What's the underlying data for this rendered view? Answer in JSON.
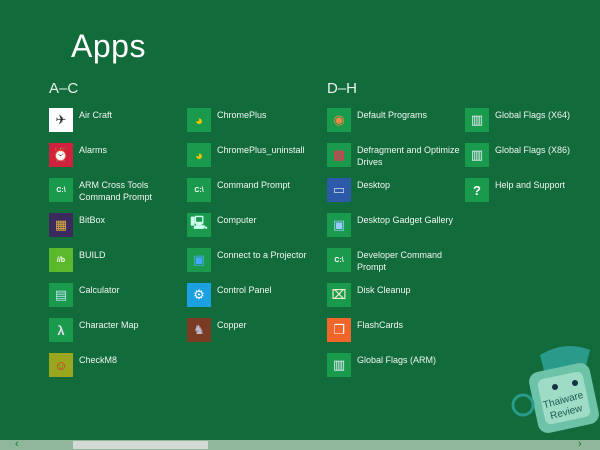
{
  "header": {
    "title": "Apps"
  },
  "groups": [
    {
      "label": "A–C"
    },
    {
      "label": "D–H"
    }
  ],
  "columns": [
    [
      {
        "label": "Air Craft",
        "icon": "paper-plane-icon",
        "bg": "#ffffff",
        "glyph": "✈",
        "fg": "#333"
      },
      {
        "label": "Alarms",
        "icon": "alarm-clock-icon",
        "bg": "#d0213f",
        "glyph": "⏰",
        "fg": "#fff"
      },
      {
        "label": "ARM Cross Tools Command Prompt",
        "icon": "command-prompt-icon",
        "bg": "#1a9a4c",
        "glyph": "C:\\",
        "fg": "#fff"
      },
      {
        "label": "BitBox",
        "icon": "bitbox-icon",
        "bg": "#3a2a5e",
        "glyph": "▦",
        "fg": "#e0b040"
      },
      {
        "label": "BUILD",
        "icon": "build-icon",
        "bg": "#5bb82c",
        "glyph": "//b",
        "fg": "#fff"
      },
      {
        "label": "Calculator",
        "icon": "calculator-icon",
        "bg": "#1a9a4c",
        "glyph": "▤",
        "fg": "#bfe0f5"
      },
      {
        "label": "Character Map",
        "icon": "character-map-icon",
        "bg": "#1a9a4c",
        "glyph": "λ",
        "fg": "#dde"
      },
      {
        "label": "CheckM8",
        "icon": "checkm8-icon",
        "bg": "#9aa61e",
        "glyph": "☺",
        "fg": "#c33"
      }
    ],
    [
      {
        "label": "ChromePlus",
        "icon": "chromeplus-icon",
        "bg": "#1a9a4c",
        "glyph": "◕",
        "fg": "#f6c200"
      },
      {
        "label": "ChromePlus_uninstall",
        "icon": "chromeplus-uninstall-icon",
        "bg": "#1a9a4c",
        "glyph": "◕",
        "fg": "#f6c200"
      },
      {
        "label": "Command Prompt",
        "icon": "command-prompt-icon",
        "bg": "#1a9a4c",
        "glyph": "C:\\",
        "fg": "#fff"
      },
      {
        "label": "Computer",
        "icon": "computer-icon",
        "bg": "#1a9a4c",
        "glyph": "🖳",
        "fg": "#cfe"
      },
      {
        "label": "Connect to a Projector",
        "icon": "projector-icon",
        "bg": "#1a9a4c",
        "glyph": "▣",
        "fg": "#4af"
      },
      {
        "label": "Control Panel",
        "icon": "gear-icon",
        "bg": "#1ba1e2",
        "glyph": "⚙",
        "fg": "#fff"
      },
      {
        "label": "Copper",
        "icon": "copper-icon",
        "bg": "#7a3b22",
        "glyph": "♞",
        "fg": "#bbc"
      }
    ],
    [
      {
        "label": "Default Programs",
        "icon": "default-programs-icon",
        "bg": "#1a9a4c",
        "glyph": "◉",
        "fg": "#e84"
      },
      {
        "label": "Defragment and Optimize Drives",
        "icon": "defrag-icon",
        "bg": "#1a9a4c",
        "glyph": "▩",
        "fg": "#e35"
      },
      {
        "label": "Desktop",
        "icon": "desktop-icon",
        "bg": "#2c5aa8",
        "glyph": "▭",
        "fg": "#cde"
      },
      {
        "label": "Desktop Gadget Gallery",
        "icon": "gadget-gallery-icon",
        "bg": "#1a9a4c",
        "glyph": "▣",
        "fg": "#9cf"
      },
      {
        "label": "Developer Command Prompt",
        "icon": "command-prompt-icon",
        "bg": "#1a9a4c",
        "glyph": "C:\\",
        "fg": "#fff"
      },
      {
        "label": "Disk Cleanup",
        "icon": "disk-cleanup-icon",
        "bg": "#1a9a4c",
        "glyph": "⌧",
        "fg": "#eec"
      },
      {
        "label": "FlashCards",
        "icon": "flashcards-icon",
        "bg": "#f0652a",
        "glyph": "❐",
        "fg": "#fff"
      },
      {
        "label": "Global Flags (ARM)",
        "icon": "global-flags-icon",
        "bg": "#1a9a4c",
        "glyph": "▥",
        "fg": "#eef"
      }
    ],
    [
      {
        "label": "Global Flags (X64)",
        "icon": "global-flags-icon",
        "bg": "#1a9a4c",
        "glyph": "▥",
        "fg": "#eef"
      },
      {
        "label": "Global Flags (X86)",
        "icon": "global-flags-icon",
        "bg": "#1a9a4c",
        "glyph": "▥",
        "fg": "#eef"
      },
      {
        "label": "Help and Support",
        "icon": "help-icon",
        "bg": "#1a9a4c",
        "glyph": "?",
        "fg": "#fff"
      }
    ]
  ],
  "watermark": {
    "text1": "Thaiware",
    "text2": "Review"
  },
  "scrollbar": {
    "left": "‹",
    "right": "›",
    "position_percent": 12
  }
}
